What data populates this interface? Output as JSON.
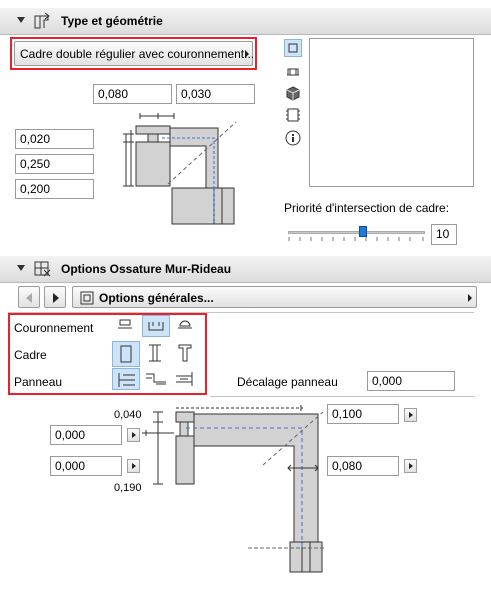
{
  "section1": {
    "title": "Type et géométrie",
    "frame_type": "Cadre double régulier avec couronnement..."
  },
  "fields": {
    "top_left": "0,080",
    "top_right": "0,030",
    "left_1": "0,020",
    "left_2": "0,250",
    "left_3": "0,200"
  },
  "priority": {
    "label": "Priorité d'intersection de cadre:",
    "value": "10",
    "slider_fraction": 0.55
  },
  "section2": {
    "title": "Options Ossature Mur-Rideau",
    "page": "Options générales..."
  },
  "options": {
    "crown_label": "Couronnement",
    "frame_label": "Cadre",
    "panel_label": "Panneau",
    "panel_offset_label": "Décalage panneau",
    "panel_offset_value": "0,000"
  },
  "diagram": {
    "dim_040": "0,040",
    "dim_190": "0,190",
    "field_left_1": "0,000",
    "field_left_2": "0,000",
    "field_right_1": "0,100",
    "field_right_2": "0,080"
  },
  "colors": {
    "highlight": "#e8212a",
    "selected": "#cde3f7",
    "shape_fill": "#d2d2d2",
    "dash_line": "#3d6fd8"
  }
}
